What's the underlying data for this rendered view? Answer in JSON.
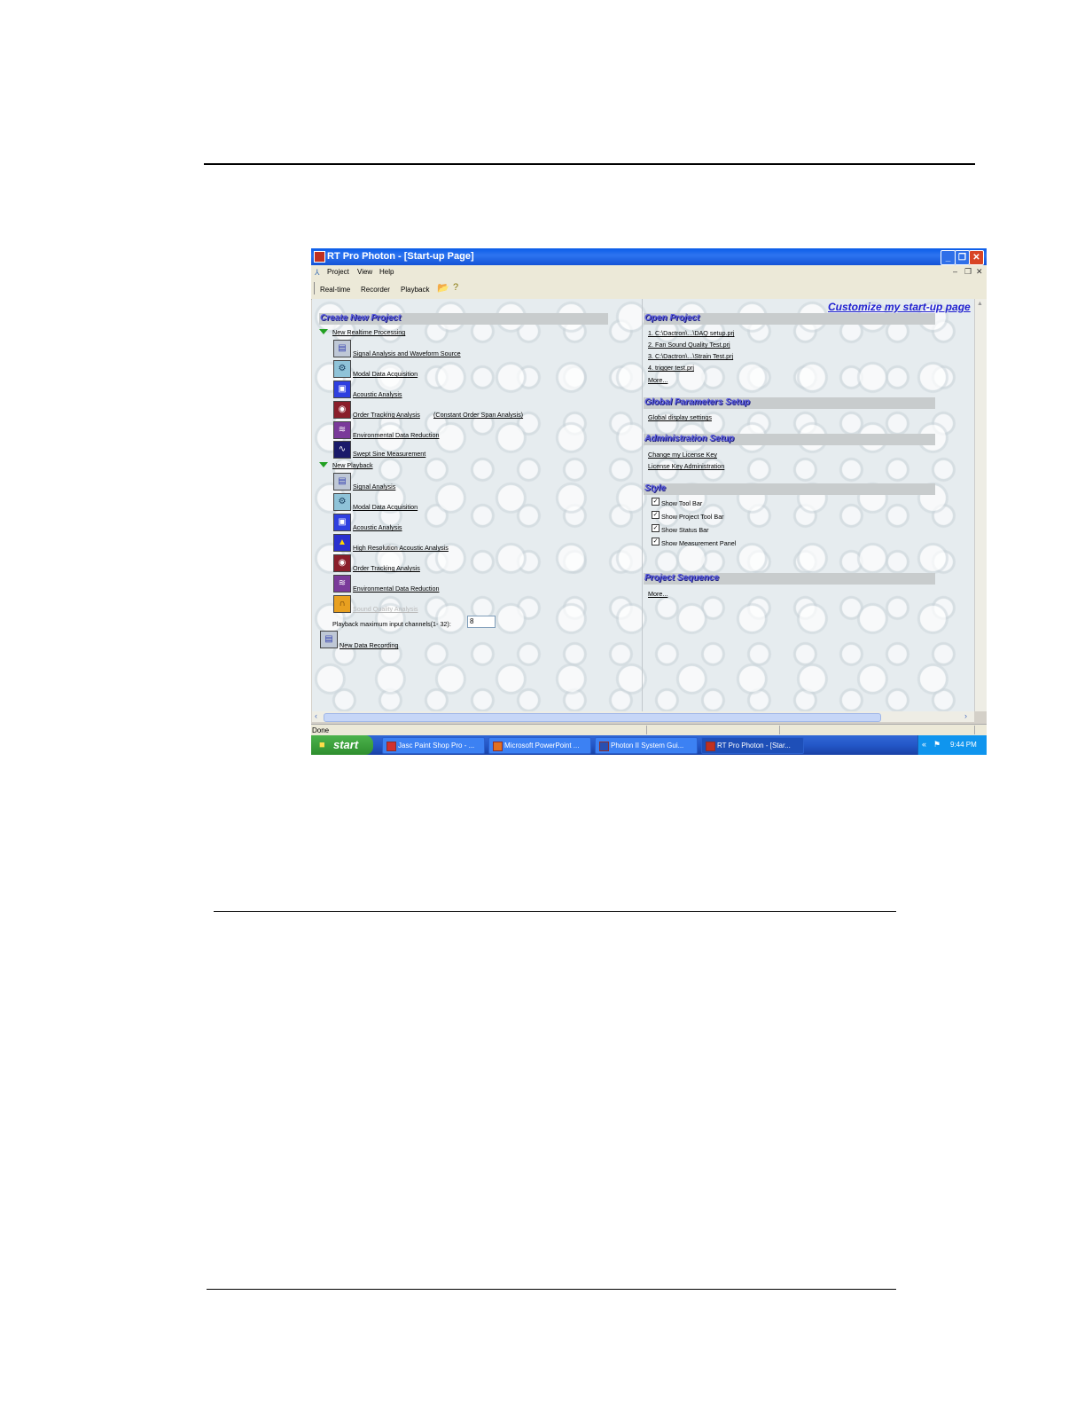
{
  "window": {
    "title": "RT Pro Photon - [Start-up Page]",
    "menu": [
      "Project",
      "View",
      "Help"
    ],
    "toolbar": [
      "Real-time",
      "Recorder",
      "Playback"
    ],
    "customize_link": "Customize my start-up page"
  },
  "left": {
    "header": "Create New Project",
    "realtime": {
      "label": "New Realtime Processing",
      "items": [
        {
          "label": "Signal Analysis and Waveform Source",
          "icon": "signal-analysis-icon"
        },
        {
          "label": "Modal Data Acquisition",
          "icon": "modal-icon"
        },
        {
          "label": "Acoustic Analysis",
          "icon": "acoustic-icon"
        },
        {
          "label": "Order Tracking Analysis",
          "extra": "(Constant Order Span Analysis)",
          "icon": "order-tracking-icon"
        },
        {
          "label": "Environmental Data Reduction",
          "icon": "environmental-icon"
        },
        {
          "label": "Swept Sine Measurement",
          "icon": "swept-sine-icon"
        }
      ]
    },
    "playback": {
      "label": "New Playback",
      "items": [
        {
          "label": "Signal Analysis",
          "icon": "signal-analysis-icon"
        },
        {
          "label": "Modal Data Acquisition",
          "icon": "modal-icon"
        },
        {
          "label": "Acoustic Analysis",
          "icon": "acoustic-icon"
        },
        {
          "label": "High Resolution Acoustic Analysis",
          "icon": "hires-acoustic-icon"
        },
        {
          "label": "Order Tracking Analysis",
          "icon": "order-tracking-icon"
        },
        {
          "label": "Environmental Data Reduction",
          "icon": "environmental-icon"
        },
        {
          "label": "Sound Quality Analysis",
          "icon": "headphones-icon",
          "disabled": true
        }
      ],
      "max_channels_label": "Playback maximum input channels(1- 32):",
      "max_channels_value": "8"
    },
    "recording": {
      "label": "New Data Recording",
      "icon": "recording-icon"
    }
  },
  "right": {
    "open_project": {
      "header": "Open Project",
      "items": [
        "1.  C:\\Dactron\\...\\DAQ setup.prj",
        "2.  Fan Sound Quality Test.prj",
        "3.  C:\\Dactron\\...\\Strain Test.prj",
        "4.  trigger test.prj"
      ],
      "more": "More..."
    },
    "global": {
      "header": "Global Parameters Setup",
      "items": [
        "Global display settings"
      ]
    },
    "admin": {
      "header": "Administration Setup",
      "items": [
        "Change my License Key",
        "License Key Administration"
      ]
    },
    "style": {
      "header": "Style",
      "items": [
        "Show Tool Bar",
        "Show Project Tool Bar",
        "Show Status Bar",
        "Show Measurement Panel"
      ]
    },
    "sequence": {
      "header": "Project Sequence",
      "more": "More..."
    }
  },
  "status": {
    "text": "Done"
  },
  "taskbar": {
    "start": "start",
    "tasks": [
      "Jasc Paint Shop Pro - ...",
      "Microsoft PowerPoint ...",
      "Photon II System Gui...",
      "RT Pro Photon - [Star..."
    ],
    "clock": "9:44 PM"
  }
}
